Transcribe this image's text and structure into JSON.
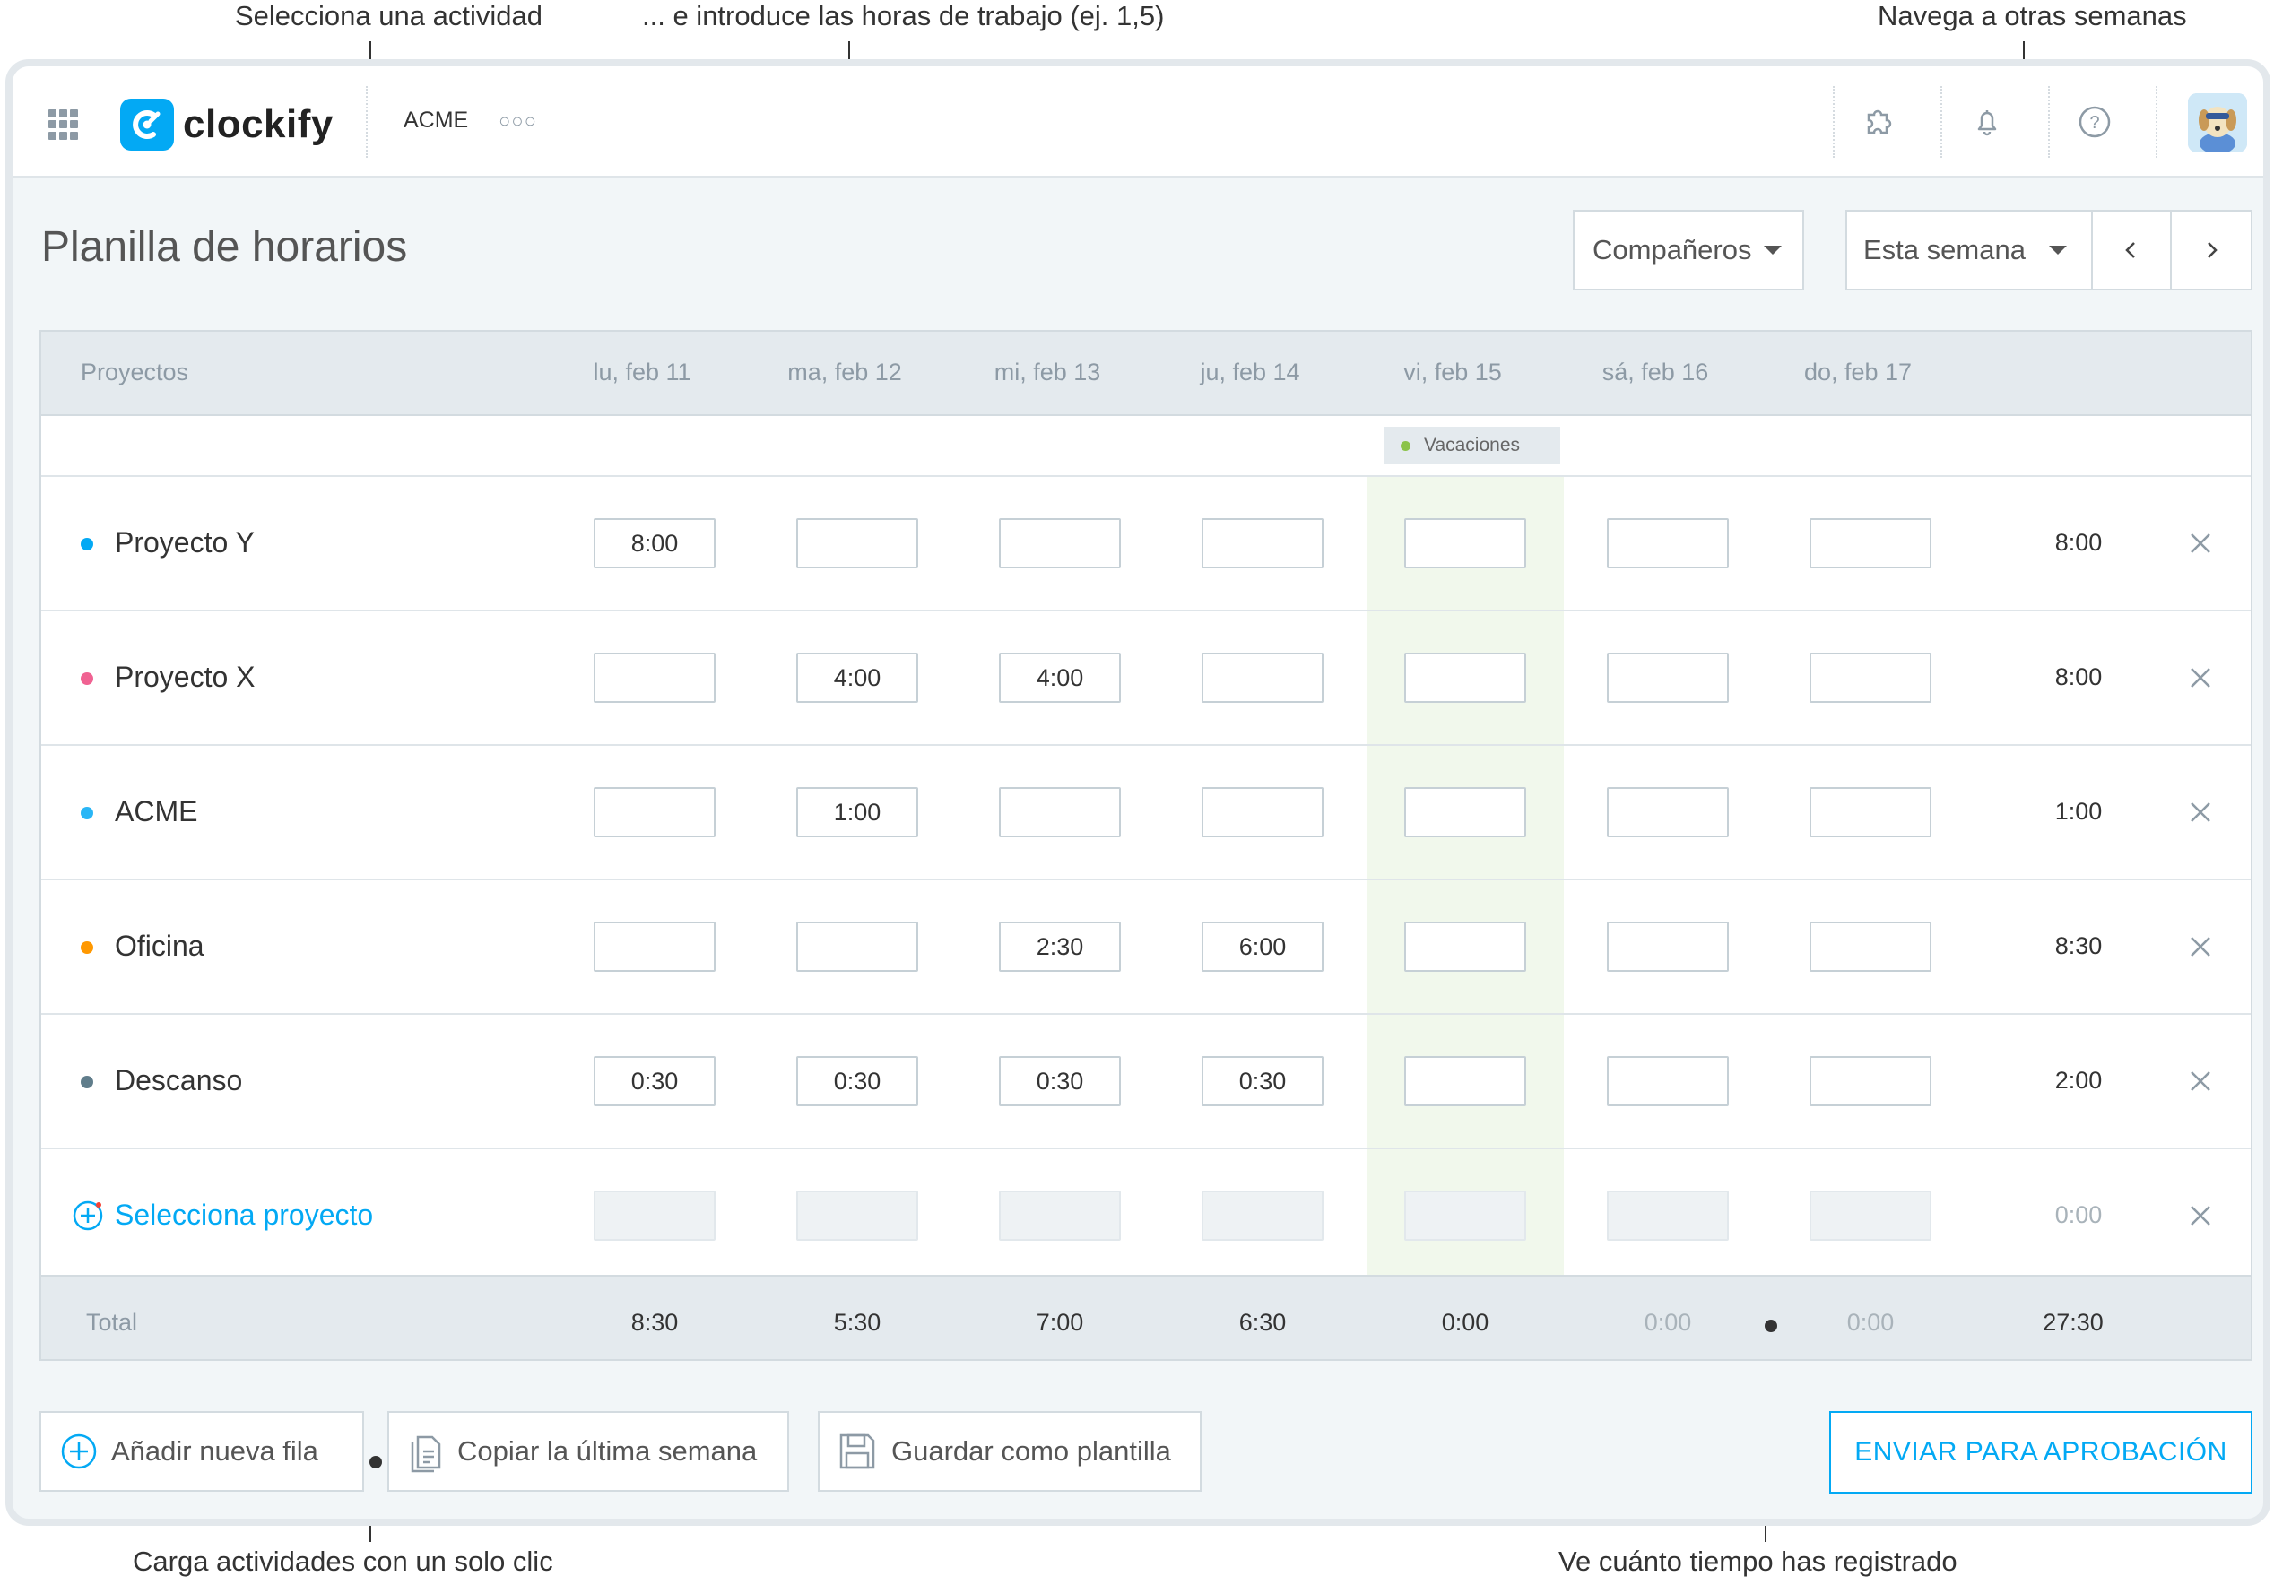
{
  "callouts": {
    "select_activity": "Selecciona una actividad",
    "enter_hours": "... e introduce las horas de trabajo (ej. 1,5)",
    "navigate_weeks": "Navega a otras semanas",
    "load_activities": "Carga actividades con un solo clic",
    "see_time": "Ve cuánto tiempo has registrado"
  },
  "topbar": {
    "logo_text": "clockify",
    "workspace": "ACME",
    "more": "○○○",
    "icons": [
      "apps-grid-icon",
      "puzzle-icon",
      "bell-icon",
      "help-icon",
      "avatar"
    ]
  },
  "page": {
    "title": "Planilla de horarios",
    "teammates_label": "Compañeros",
    "week_label": "Esta semana"
  },
  "table": {
    "projects_header": "Proyectos",
    "days": [
      "lu, feb 11",
      "ma, feb 12",
      "mi, feb 13",
      "ju, feb 14",
      "vi, feb 15",
      "sá, feb 16",
      "do, feb 17"
    ],
    "holiday_label": "Vacaciones",
    "rows": [
      {
        "name": "Proyecto Y",
        "color": "#03a9f4",
        "cells": [
          "8:00",
          "",
          "",
          "",
          "",
          "",
          ""
        ],
        "total": "8:00"
      },
      {
        "name": "Proyecto X",
        "color": "#f06292",
        "cells": [
          "",
          "4:00",
          "4:00",
          "",
          "",
          "",
          ""
        ],
        "total": "8:00"
      },
      {
        "name": "ACME",
        "color": "#29b6f6",
        "cells": [
          "",
          "1:00",
          "",
          "",
          "",
          "",
          ""
        ],
        "total": "1:00"
      },
      {
        "name": "Oficina",
        "color": "#ff9800",
        "cells": [
          "",
          "",
          "2:30",
          "6:00",
          "",
          "",
          ""
        ],
        "total": "8:30"
      },
      {
        "name": "Descanso",
        "color": "#607d8b",
        "cells": [
          "0:30",
          "0:30",
          "0:30",
          "0:30",
          "",
          "",
          ""
        ],
        "total": "2:00"
      }
    ],
    "select_project": "Selecciona proyecto",
    "select_project_total": "0:00",
    "total_label": "Total",
    "day_totals": [
      "8:30",
      "5:30",
      "7:00",
      "6:30",
      "0:00",
      "0:00",
      "0:00"
    ],
    "grand_total": "27:30"
  },
  "actions": {
    "add_row": "Añadir nueva fila",
    "copy_last_week": "Copiar la última semana",
    "save_template": "Guardar como plantilla",
    "submit": "ENVIAR PARA APROBACIÓN"
  },
  "colors": {
    "accent": "#03a9f4",
    "holiday_bg": "#f1f8ec",
    "holiday_dot": "#8bc34a"
  }
}
